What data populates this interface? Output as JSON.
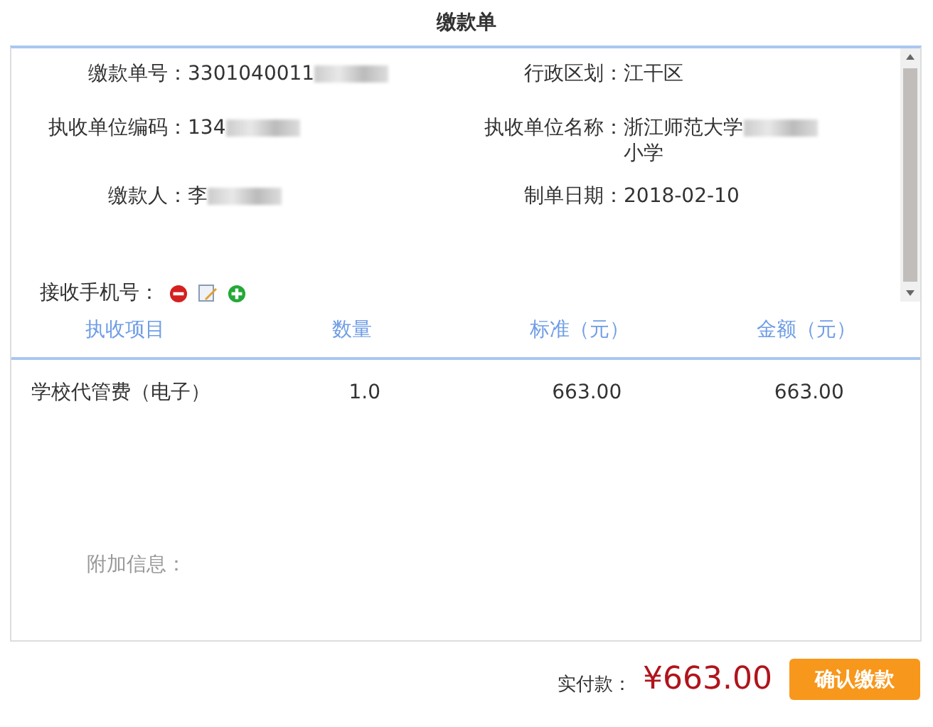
{
  "title": "缴款单",
  "fields": [
    {
      "label": "缴款单号：",
      "value": "3301040011",
      "redacted": true
    },
    {
      "label": "行政区划：",
      "value": "江干区",
      "redacted": false
    },
    {
      "label": "执收单位编码：",
      "value": "134",
      "redacted": true
    },
    {
      "label": "执收单位名称：",
      "value": "浙江师范大学",
      "value_end": "小学",
      "redacted": true
    },
    {
      "label": "缴款人：",
      "value": "李",
      "redacted": true
    },
    {
      "label": "制单日期：",
      "value": "2018-02-10",
      "redacted": false
    }
  ],
  "phone": {
    "label": "接收手机号："
  },
  "table": {
    "columns": [
      "执收项目",
      "数量",
      "标准（元）",
      "金额（元）"
    ],
    "rows": [
      [
        "学校代管费（电子）",
        "1.0",
        "663.00",
        "663.00"
      ]
    ]
  },
  "extra": {
    "label": "附加信息："
  },
  "footer": {
    "label": "实付款：",
    "amount": "¥663.00",
    "button": "确认缴款"
  }
}
